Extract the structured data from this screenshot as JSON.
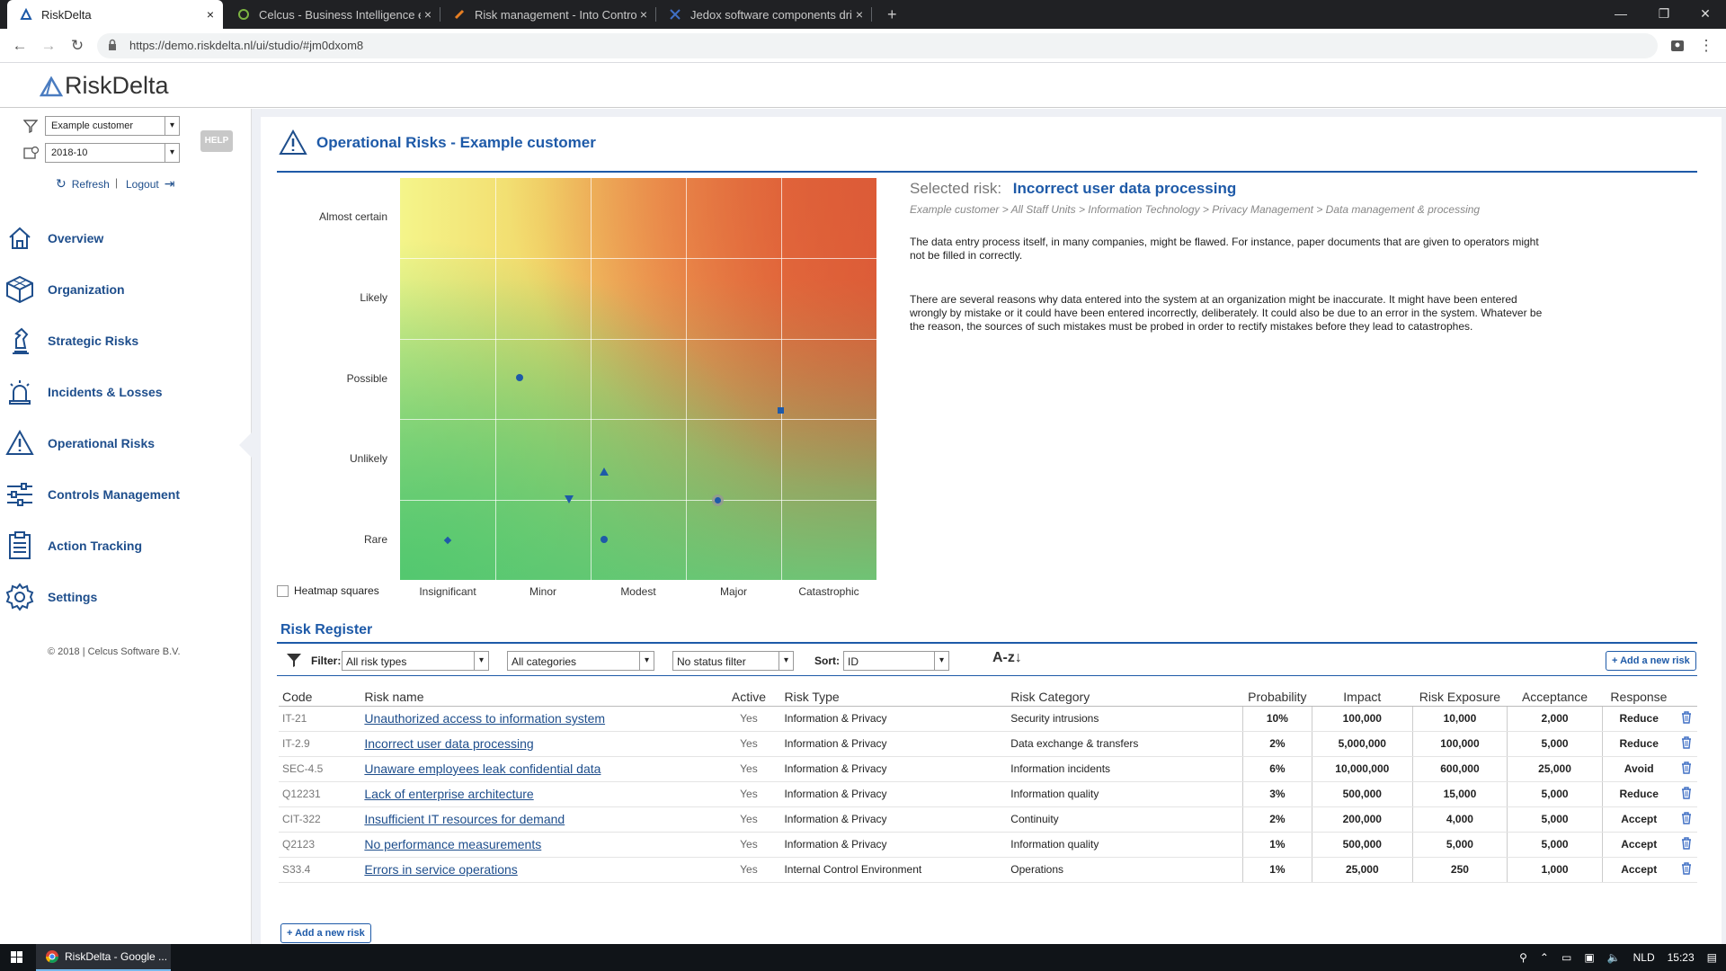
{
  "browser": {
    "tabs": [
      {
        "title": "RiskDelta",
        "close": "×"
      },
      {
        "title": "Celcus - Business Intelligence en",
        "close": "×"
      },
      {
        "title": "Risk management - Into Control",
        "close": "×"
      },
      {
        "title": "Jedox software components driv",
        "close": "×"
      }
    ],
    "new_tab": "+",
    "window_controls": {
      "minimize": "—",
      "restore": "❐",
      "close": "✕"
    },
    "url": "https://demo.riskdelta.nl/ui/studio/#jm0dxom8",
    "nav": {
      "back": "←",
      "forward": "→",
      "reload": "↻",
      "menu": "⋮"
    }
  },
  "app": {
    "logo_text": "RiskDelta"
  },
  "sidebar": {
    "customer_select": "Example customer",
    "period_select": "2018-10",
    "help_label": "HELP",
    "refresh_label": "Refresh",
    "logout_label": "Logout",
    "menu": [
      {
        "label": "Overview",
        "icon": "home-icon"
      },
      {
        "label": "Organization",
        "icon": "cube-icon"
      },
      {
        "label": "Strategic Risks",
        "icon": "chess-icon"
      },
      {
        "label": "Incidents & Losses",
        "icon": "alarm-icon"
      },
      {
        "label": "Operational Risks",
        "icon": "warning-icon"
      },
      {
        "label": "Controls Management",
        "icon": "sliders-icon"
      },
      {
        "label": "Action Tracking",
        "icon": "clipboard-icon"
      },
      {
        "label": "Settings",
        "icon": "gear-icon"
      }
    ],
    "copyright": "© 2018 | Celcus Software B.V."
  },
  "main": {
    "title": "Operational Risks - Example customer",
    "heatmap": {
      "y_labels": [
        "Almost certain",
        "Likely",
        "Possible",
        "Unlikely",
        "Rare"
      ],
      "x_labels": [
        "Insignificant",
        "Minor",
        "Modest",
        "Major",
        "Catastrophic"
      ],
      "toggle_label": "Heatmap squares"
    },
    "selected_risk": {
      "label": "Selected risk:",
      "name": "Incorrect user data processing",
      "path": "Example customer > All Staff Units > Information Technology > Privacy Management > Data management & processing",
      "description_1": "The data entry process itself, in many companies, might be flawed. For instance, paper documents that are given to operators might not be filled in correctly.",
      "description_2": "There are several reasons why data entered into the system at an organization might be inaccurate. It might have been entered wrongly by mistake or it could have been entered incorrectly, deliberately. It could also be due to an error in the system. Whatever be the reason, the sources of such mistakes must be probed in order to rectify mistakes before they lead to catastrophes."
    },
    "register": {
      "title": "Risk Register",
      "filter_label": "Filter:",
      "risk_type_filter": "All risk types",
      "category_filter": "All categories",
      "status_filter": "No status filter",
      "sort_label": "Sort:",
      "sort_value": "ID",
      "sort_direction": "A-z↓",
      "add_button": "+ Add a new risk",
      "add_button_bottom": "+ Add a new risk",
      "columns": [
        "Code",
        "Risk name",
        "Active",
        "Risk Type",
        "Risk Category",
        "Probability",
        "Impact",
        "Risk Exposure",
        "Acceptance",
        "Response"
      ],
      "rows": [
        {
          "code": "IT-21",
          "name": "Unauthorized access to information system",
          "active": "Yes",
          "type": "Information & Privacy",
          "category": "Security intrusions",
          "probability": "10%",
          "impact": "100,000",
          "exposure": "10,000",
          "acceptance": "2,000",
          "response": "Reduce"
        },
        {
          "code": "IT-2.9",
          "name": "Incorrect user data processing",
          "active": "Yes",
          "type": "Information & Privacy",
          "category": "Data exchange & transfers",
          "probability": "2%",
          "impact": "5,000,000",
          "exposure": "100,000",
          "acceptance": "5,000",
          "response": "Reduce"
        },
        {
          "code": "SEC-4.5",
          "name": "Unaware employees leak confidential data",
          "active": "Yes",
          "type": "Information & Privacy",
          "category": "Information incidents",
          "probability": "6%",
          "impact": "10,000,000",
          "exposure": "600,000",
          "acceptance": "25,000",
          "response": "Avoid"
        },
        {
          "code": "Q12231",
          "name": "Lack of enterprise architecture",
          "active": "Yes",
          "type": "Information & Privacy",
          "category": "Information quality",
          "probability": "3%",
          "impact": "500,000",
          "exposure": "15,000",
          "acceptance": "5,000",
          "response": "Reduce"
        },
        {
          "code": "CIT-322",
          "name": "Insufficient IT resources for demand",
          "active": "Yes",
          "type": "Information & Privacy",
          "category": "Continuity",
          "probability": "2%",
          "impact": "200,000",
          "exposure": "4,000",
          "acceptance": "5,000",
          "response": "Accept"
        },
        {
          "code": "Q2123",
          "name": "No performance measurements",
          "active": "Yes",
          "type": "Information & Privacy",
          "category": "Information quality",
          "probability": "1%",
          "impact": "500,000",
          "exposure": "5,000",
          "acceptance": "5,000",
          "response": "Accept"
        },
        {
          "code": "S33.4",
          "name": "Errors in service operations",
          "active": "Yes",
          "type": "Internal Control Environment",
          "category": "Operations",
          "probability": "1%",
          "impact": "25,000",
          "exposure": "250",
          "acceptance": "1,000",
          "response": "Accept"
        }
      ]
    }
  },
  "taskbar": {
    "window_label": "RiskDelta - Google ...",
    "language": "NLD",
    "time": "15:23"
  },
  "colors": {
    "accent": "#1e5aa8",
    "nav_text": "#1e4e8c"
  }
}
